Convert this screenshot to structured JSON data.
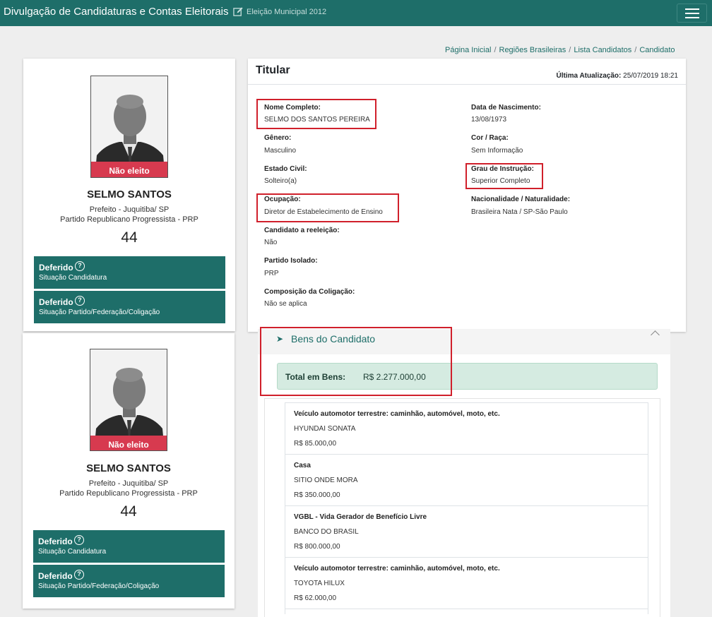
{
  "header": {
    "app_title": "Divulgação de Candidaturas e Contas Eleitorais",
    "election": "Eleição Municipal 2012",
    "brand_color": "#1e6e69"
  },
  "breadcrumb": [
    "Página Inicial",
    "Regiões Brasileiras",
    "Lista Candidatos",
    "Candidato"
  ],
  "candidate": {
    "photo_badge": "Não eleito",
    "name": "SELMO SANTOS",
    "office": "Prefeito - Juquitiba/ SP",
    "party": "Partido Republicano Progressista - PRP",
    "number": "44",
    "statuses": [
      {
        "title": "Deferido",
        "subtitle": "Situação Candidatura"
      },
      {
        "title": "Deferido",
        "subtitle": "Situação Partido/Federação/Coligação"
      }
    ]
  },
  "details": {
    "title": "Titular",
    "updated_label": "Última Atualização:",
    "updated_value": "25/07/2019 18:21",
    "left_fields": [
      {
        "label": "Nome Completo:",
        "value": "SELMO DOS SANTOS PEREIRA"
      },
      {
        "label": "Gênero:",
        "value": "Masculino"
      },
      {
        "label": "Estado Civil:",
        "value": "Solteiro(a)"
      },
      {
        "label": "Ocupação:",
        "value": "Diretor de Estabelecimento de Ensino"
      },
      {
        "label": "Candidato a reeleição:",
        "value": "Não"
      },
      {
        "label": "Partido Isolado:",
        "value": "PRP"
      },
      {
        "label": "Composição da Coligação:",
        "value": "Não se aplica"
      }
    ],
    "right_fields": [
      {
        "label": "Data de Nascimento:",
        "value": "13/08/1973"
      },
      {
        "label": "Cor / Raça:",
        "value": "Sem Informação"
      },
      {
        "label": "Grau de Instrução:",
        "value": "Superior Completo"
      },
      {
        "label": "Nacionalidade / Naturalidade:",
        "value": "Brasileira Nata / SP-São Paulo"
      }
    ]
  },
  "assets": {
    "title": "Bens do Candidato",
    "total_label": "Total em Bens:",
    "total_value": "R$ 2.277.000,00",
    "items": [
      {
        "type": "Veículo automotor terrestre: caminhão, automóvel, moto, etc.",
        "description": "HYUNDAI SONATA",
        "value": "R$ 85.000,00"
      },
      {
        "type": "Casa",
        "description": "SITIO ONDE MORA",
        "value": "R$ 350.000,00"
      },
      {
        "type": "VGBL - Vida Gerador de Benefício Livre",
        "description": "BANCO DO BRASIL",
        "value": "R$ 800.000,00"
      },
      {
        "type": "Veículo automotor terrestre: caminhão, automóvel, moto, etc.",
        "description": "TOYOTA HILUX",
        "value": "R$ 62.000,00"
      }
    ]
  }
}
